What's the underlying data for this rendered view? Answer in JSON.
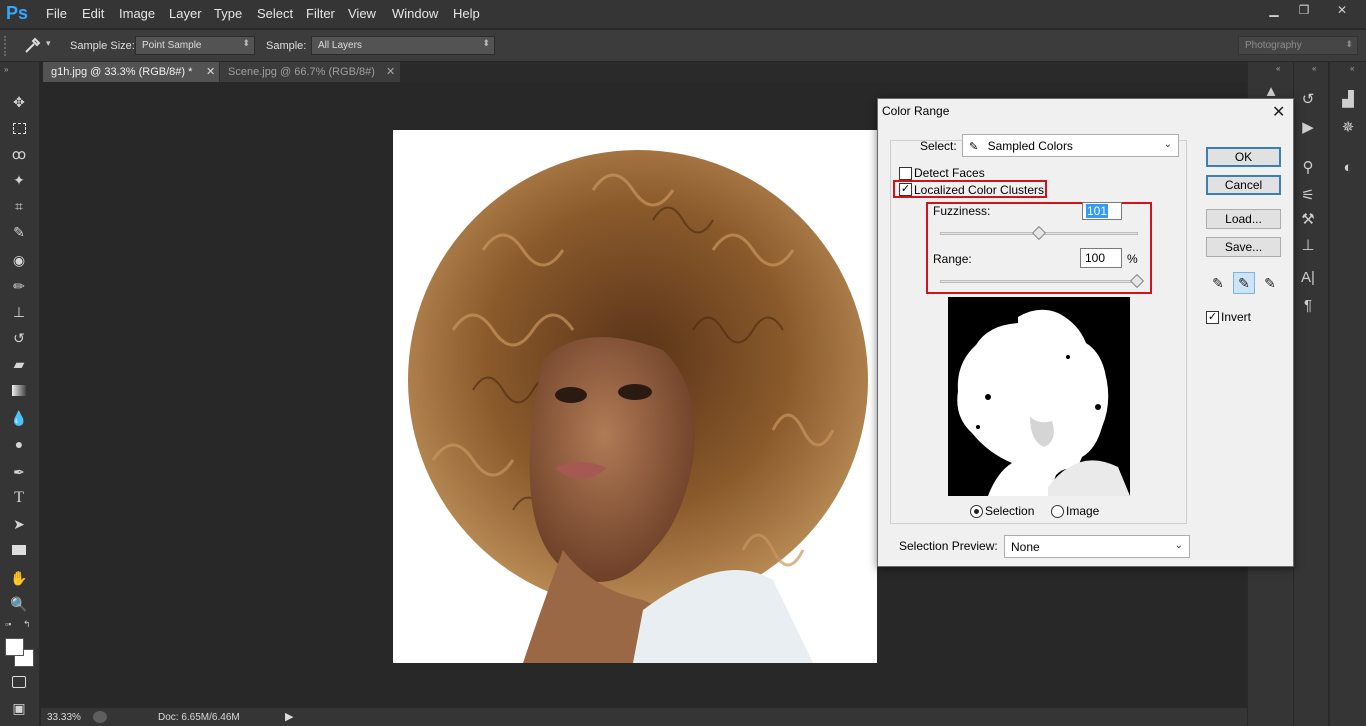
{
  "app": {
    "logo": "Ps"
  },
  "menu": [
    "File",
    "Edit",
    "Image",
    "Layer",
    "Type",
    "Select",
    "Filter",
    "View",
    "Window",
    "Help"
  ],
  "options_bar": {
    "sample_size_label": "Sample Size:",
    "sample_size_value": "Point Sample",
    "sample_label": "Sample:",
    "sample_value": "All Layers",
    "workspace_value": "Photography"
  },
  "tabs": [
    {
      "label": "g1h.jpg @ 33.3% (RGB/8#) *",
      "active": true
    },
    {
      "label": "Scene.jpg @ 66.7% (RGB/8#)",
      "active": false
    }
  ],
  "status": {
    "zoom": "33.33%",
    "doc": "Doc: 6.65M/6.46M"
  },
  "dialog": {
    "title": "Color Range",
    "select_label": "Select:",
    "select_value": "Sampled Colors",
    "detect_faces_label": "Detect Faces",
    "detect_faces_checked": false,
    "localized_label": "Localized Color Clusters",
    "localized_checked": true,
    "fuzziness_label": "Fuzziness:",
    "fuzziness_value": "101",
    "range_label": "Range:",
    "range_value": "100",
    "range_unit": "%",
    "ok_label": "OK",
    "cancel_label": "Cancel",
    "load_label": "Load...",
    "save_label": "Save...",
    "invert_label": "Invert",
    "invert_checked": true,
    "selection_radio_label": "Selection",
    "image_radio_label": "Image",
    "preview_label": "Selection Preview:",
    "preview_value": "None",
    "close_glyph": "✕"
  },
  "colors": {
    "accent_red": "#d0141d",
    "ps_blue": "#31a8ff"
  }
}
